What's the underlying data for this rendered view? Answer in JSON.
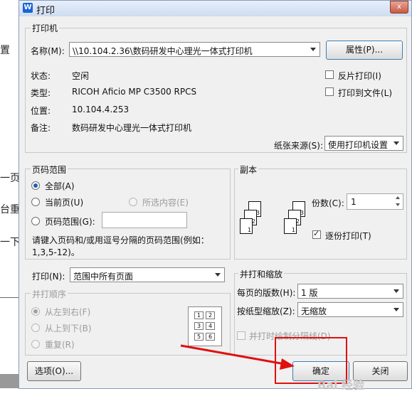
{
  "background_doc": {
    "fragments": [
      "置",
      "一页",
      "台重",
      "一下"
    ]
  },
  "dialog": {
    "title": "打印",
    "app_icon": "W",
    "close_glyph": "x"
  },
  "printer": {
    "group_label": "打印机",
    "name_label": "名称(M):",
    "name_value": "\\\\10.104.2.36\\数码研发中心理光一体式打印机",
    "properties_button": "属性(P)...",
    "status_label": "状态:",
    "status_value": "空闲",
    "type_label": "类型:",
    "type_value": "RICOH Aficio MP C3500 RPCS",
    "location_label": "位置:",
    "location_value": "10.104.4.253",
    "comment_label": "备注:",
    "comment_value": "数码研发中心理光一体式打印机",
    "reverse_print": "反片打印(I)",
    "print_to_file": "打印到文件(L)",
    "paper_source_label": "纸张来源(S):",
    "paper_source_value": "使用打印机设置"
  },
  "page_range": {
    "group_label": "页码范围",
    "all": "全部(A)",
    "current": "当前页(U)",
    "selection": "所选内容(E)",
    "pages": "页码范围(G):",
    "pages_value": "",
    "hint_line1": "请键入页码和/或用逗号分隔的页码范围(例如：",
    "hint_line2": "1,3,5-12)。"
  },
  "copies": {
    "group_label": "副本",
    "count_label": "份数(C):",
    "count_value": "1",
    "collate": "逐份打印(T)",
    "collate_checked": true
  },
  "print_what": {
    "label": "打印(N):",
    "value": "范围中所有页面"
  },
  "merge_order": {
    "group_label": "并打顺序",
    "left_to_right": "从左到右(F)",
    "top_to_bottom": "从上到下(B)",
    "repeat": "重复(R)",
    "grid_numbers": [
      "1",
      "2",
      "3",
      "4",
      "5",
      "6"
    ]
  },
  "zoom": {
    "group_label": "并打和缩放",
    "pages_per_sheet_label": "每页的版数(H):",
    "pages_per_sheet_value": "1 版",
    "scale_label": "按纸型缩放(Z):",
    "scale_value": "无缩放",
    "draw_divider": "并打时绘制分隔线(D)"
  },
  "buttons": {
    "options": "选项(O)...",
    "ok": "确定",
    "close": "关闭"
  },
  "watermark": "Bai 经验",
  "annotation_color": "#e01010"
}
